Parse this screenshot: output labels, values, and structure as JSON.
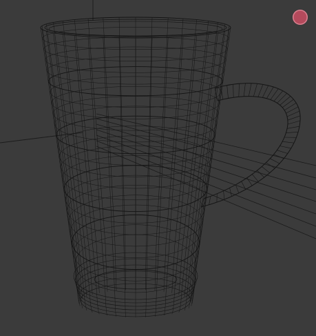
{
  "viewport": {
    "mode": "wireframe",
    "background_color": "#3b3b3b",
    "wire_color": "#141414",
    "object": "mug-mesh"
  },
  "record_button": {
    "icon": "record-icon",
    "color": "#b44a5c"
  }
}
